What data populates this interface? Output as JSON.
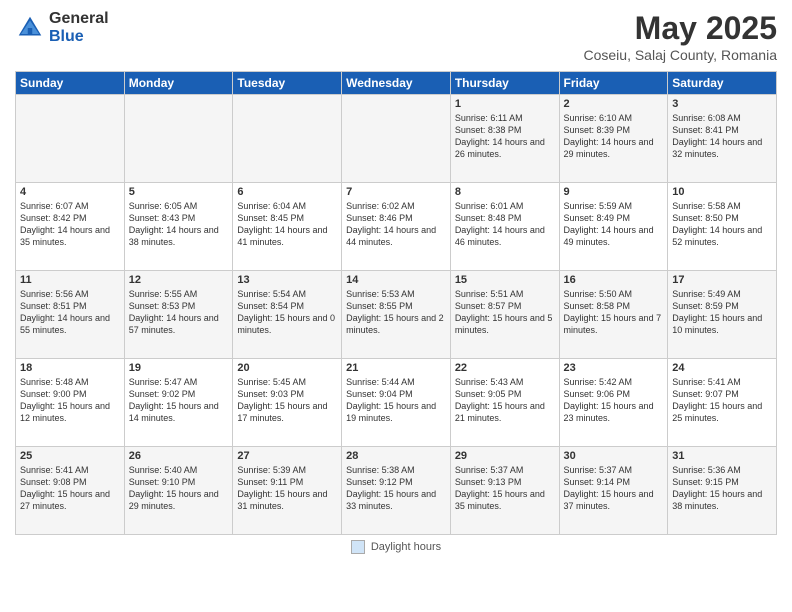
{
  "header": {
    "logo_general": "General",
    "logo_blue": "Blue",
    "title": "May 2025",
    "subtitle": "Coseiu, Salaj County, Romania"
  },
  "days_of_week": [
    "Sunday",
    "Monday",
    "Tuesday",
    "Wednesday",
    "Thursday",
    "Friday",
    "Saturday"
  ],
  "footer_label": "Daylight hours",
  "weeks": [
    [
      {
        "day": "",
        "info": ""
      },
      {
        "day": "",
        "info": ""
      },
      {
        "day": "",
        "info": ""
      },
      {
        "day": "",
        "info": ""
      },
      {
        "day": "1",
        "info": "Sunrise: 6:11 AM\nSunset: 8:38 PM\nDaylight: 14 hours and 26 minutes."
      },
      {
        "day": "2",
        "info": "Sunrise: 6:10 AM\nSunset: 8:39 PM\nDaylight: 14 hours and 29 minutes."
      },
      {
        "day": "3",
        "info": "Sunrise: 6:08 AM\nSunset: 8:41 PM\nDaylight: 14 hours and 32 minutes."
      }
    ],
    [
      {
        "day": "4",
        "info": "Sunrise: 6:07 AM\nSunset: 8:42 PM\nDaylight: 14 hours and 35 minutes."
      },
      {
        "day": "5",
        "info": "Sunrise: 6:05 AM\nSunset: 8:43 PM\nDaylight: 14 hours and 38 minutes."
      },
      {
        "day": "6",
        "info": "Sunrise: 6:04 AM\nSunset: 8:45 PM\nDaylight: 14 hours and 41 minutes."
      },
      {
        "day": "7",
        "info": "Sunrise: 6:02 AM\nSunset: 8:46 PM\nDaylight: 14 hours and 44 minutes."
      },
      {
        "day": "8",
        "info": "Sunrise: 6:01 AM\nSunset: 8:48 PM\nDaylight: 14 hours and 46 minutes."
      },
      {
        "day": "9",
        "info": "Sunrise: 5:59 AM\nSunset: 8:49 PM\nDaylight: 14 hours and 49 minutes."
      },
      {
        "day": "10",
        "info": "Sunrise: 5:58 AM\nSunset: 8:50 PM\nDaylight: 14 hours and 52 minutes."
      }
    ],
    [
      {
        "day": "11",
        "info": "Sunrise: 5:56 AM\nSunset: 8:51 PM\nDaylight: 14 hours and 55 minutes."
      },
      {
        "day": "12",
        "info": "Sunrise: 5:55 AM\nSunset: 8:53 PM\nDaylight: 14 hours and 57 minutes."
      },
      {
        "day": "13",
        "info": "Sunrise: 5:54 AM\nSunset: 8:54 PM\nDaylight: 15 hours and 0 minutes."
      },
      {
        "day": "14",
        "info": "Sunrise: 5:53 AM\nSunset: 8:55 PM\nDaylight: 15 hours and 2 minutes."
      },
      {
        "day": "15",
        "info": "Sunrise: 5:51 AM\nSunset: 8:57 PM\nDaylight: 15 hours and 5 minutes."
      },
      {
        "day": "16",
        "info": "Sunrise: 5:50 AM\nSunset: 8:58 PM\nDaylight: 15 hours and 7 minutes."
      },
      {
        "day": "17",
        "info": "Sunrise: 5:49 AM\nSunset: 8:59 PM\nDaylight: 15 hours and 10 minutes."
      }
    ],
    [
      {
        "day": "18",
        "info": "Sunrise: 5:48 AM\nSunset: 9:00 PM\nDaylight: 15 hours and 12 minutes."
      },
      {
        "day": "19",
        "info": "Sunrise: 5:47 AM\nSunset: 9:02 PM\nDaylight: 15 hours and 14 minutes."
      },
      {
        "day": "20",
        "info": "Sunrise: 5:45 AM\nSunset: 9:03 PM\nDaylight: 15 hours and 17 minutes."
      },
      {
        "day": "21",
        "info": "Sunrise: 5:44 AM\nSunset: 9:04 PM\nDaylight: 15 hours and 19 minutes."
      },
      {
        "day": "22",
        "info": "Sunrise: 5:43 AM\nSunset: 9:05 PM\nDaylight: 15 hours and 21 minutes."
      },
      {
        "day": "23",
        "info": "Sunrise: 5:42 AM\nSunset: 9:06 PM\nDaylight: 15 hours and 23 minutes."
      },
      {
        "day": "24",
        "info": "Sunrise: 5:41 AM\nSunset: 9:07 PM\nDaylight: 15 hours and 25 minutes."
      }
    ],
    [
      {
        "day": "25",
        "info": "Sunrise: 5:41 AM\nSunset: 9:08 PM\nDaylight: 15 hours and 27 minutes."
      },
      {
        "day": "26",
        "info": "Sunrise: 5:40 AM\nSunset: 9:10 PM\nDaylight: 15 hours and 29 minutes."
      },
      {
        "day": "27",
        "info": "Sunrise: 5:39 AM\nSunset: 9:11 PM\nDaylight: 15 hours and 31 minutes."
      },
      {
        "day": "28",
        "info": "Sunrise: 5:38 AM\nSunset: 9:12 PM\nDaylight: 15 hours and 33 minutes."
      },
      {
        "day": "29",
        "info": "Sunrise: 5:37 AM\nSunset: 9:13 PM\nDaylight: 15 hours and 35 minutes."
      },
      {
        "day": "30",
        "info": "Sunrise: 5:37 AM\nSunset: 9:14 PM\nDaylight: 15 hours and 37 minutes."
      },
      {
        "day": "31",
        "info": "Sunrise: 5:36 AM\nSunset: 9:15 PM\nDaylight: 15 hours and 38 minutes."
      }
    ]
  ]
}
